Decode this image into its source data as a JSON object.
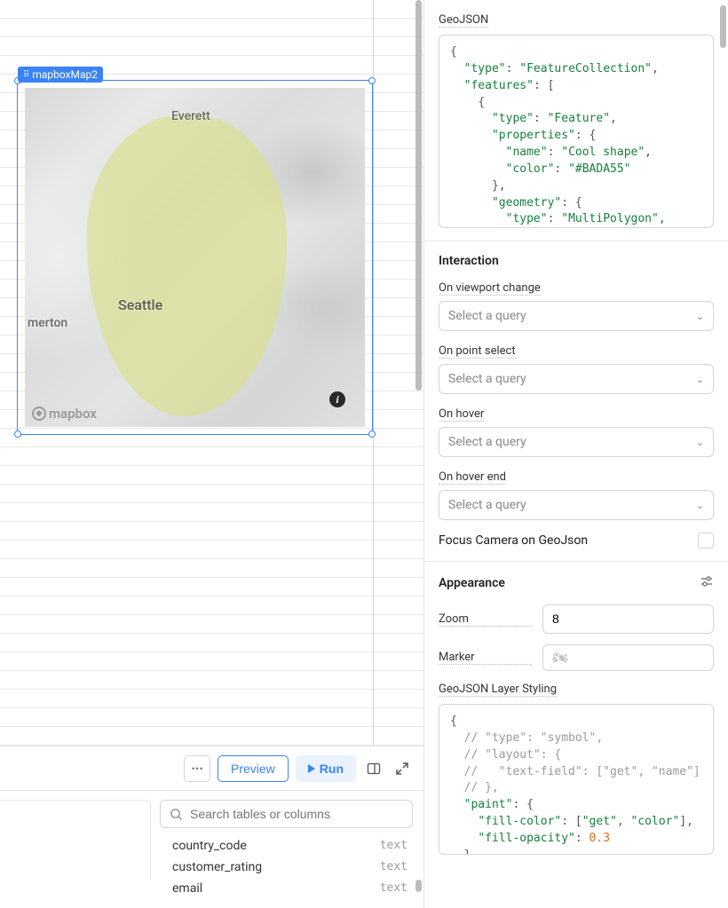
{
  "canvas": {
    "component_tag": "mapboxMap2",
    "map_labels": {
      "everett": "Everett",
      "seattle": "Seattle",
      "merton": "merton"
    },
    "attribution": "mapbox"
  },
  "toolbar": {
    "preview_label": "Preview",
    "run_label": "Run"
  },
  "bottom_panel": {
    "search_placeholder": "Search tables or columns",
    "fields": [
      {
        "name": "country_code",
        "type": "text"
      },
      {
        "name": "customer_rating",
        "type": "text"
      },
      {
        "name": "email",
        "type": "text"
      }
    ]
  },
  "right_panel": {
    "geojson_label": "GeoJSON",
    "geojson_code_html": "<span class='tok-punc'>{</span>\n  <span class='tok-key'>\"type\"</span><span class='tok-punc'>:</span> <span class='tok-str'>\"FeatureCollection\"</span><span class='tok-punc'>,</span>\n  <span class='tok-key'>\"features\"</span><span class='tok-punc'>:</span> <span class='tok-punc'>[</span>\n    <span class='tok-punc'>{</span>\n      <span class='tok-key'>\"type\"</span><span class='tok-punc'>:</span> <span class='tok-str'>\"Feature\"</span><span class='tok-punc'>,</span>\n      <span class='tok-key'>\"properties\"</span><span class='tok-punc'>:</span> <span class='tok-punc'>{</span>\n        <span class='tok-key'>\"name\"</span><span class='tok-punc'>:</span> <span class='tok-str'>\"Cool shape\"</span><span class='tok-punc'>,</span>\n        <span class='tok-key'>\"color\"</span><span class='tok-punc'>:</span> <span class='tok-str'>\"#BADA55\"</span>\n      <span class='tok-punc'>},</span>\n      <span class='tok-key'>\"geometry\"</span><span class='tok-punc'>:</span> <span class='tok-punc'>{</span>\n        <span class='tok-key'>\"type\"</span><span class='tok-punc'>:</span> <span class='tok-str'>\"MultiPolygon\"</span><span class='tok-punc'>,</span>\n        <span class='tok-key'>\"coordinates\"</span><span class='tok-punc'>:</span> <span class='tok-punc'>[</span>\n          <span class='tok-punc'>[</span>",
    "interaction": {
      "title": "Interaction",
      "viewport_change_label": "On viewport change",
      "point_select_label": "On point select",
      "hover_label": "On hover",
      "hover_end_label": "On hover end",
      "select_placeholder": "Select a query",
      "focus_camera_label": "Focus Camera on GeoJson"
    },
    "appearance": {
      "title": "Appearance",
      "zoom_label": "Zoom",
      "zoom_value": "8",
      "marker_label": "Marker",
      "marker_placeholder": "🏍",
      "styling_label": "GeoJSON Layer Styling",
      "styling_code_html": "<span class='tok-punc'>{</span>\n  <span class='tok-comment'>// \"type\": \"symbol\",</span>\n  <span class='tok-comment'>// \"layout\": {</span>\n  <span class='tok-comment'>//   \"text-field\": [\"get\", \"name\"]</span>\n  <span class='tok-comment'>// },</span>\n  <span class='tok-key'>\"paint\"</span><span class='tok-punc'>:</span> <span class='tok-punc'>{</span>\n    <span class='tok-key'>\"fill-color\"</span><span class='tok-punc'>:</span> <span class='tok-punc'>[</span><span class='tok-str'>\"get\"</span><span class='tok-punc'>,</span> <span class='tok-str'>\"color\"</span><span class='tok-punc'>],</span>\n    <span class='tok-key'>\"fill-opacity\"</span><span class='tok-punc'>:</span> <span class='tok-num'>0.3</span>\n  <span class='tok-punc'>}</span>\n<span class='tok-punc'>}</span>"
    }
  }
}
